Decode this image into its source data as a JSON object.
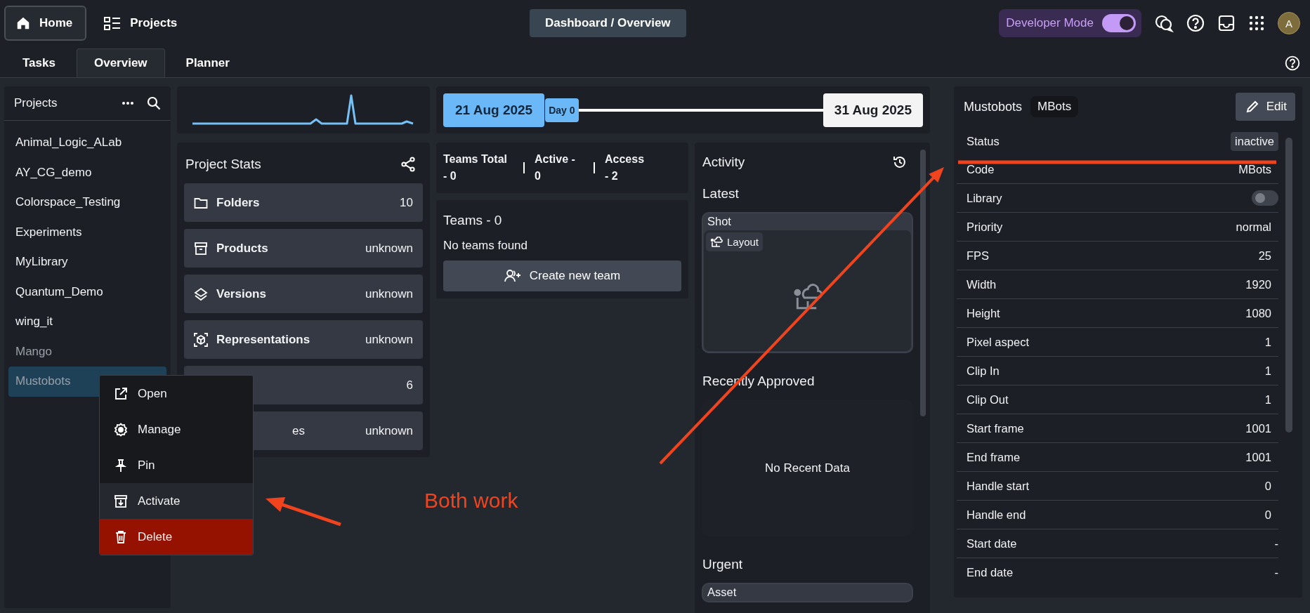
{
  "topbar": {
    "home": "Home",
    "projects": "Projects",
    "breadcrumb": "Dashboard / Overview",
    "developer_mode": {
      "label": "Developer Mode",
      "on": true
    },
    "avatar": "A"
  },
  "tabs": [
    {
      "label": "Tasks",
      "selected": false
    },
    {
      "label": "Overview",
      "selected": true
    },
    {
      "label": "Planner",
      "selected": false
    }
  ],
  "sidebar": {
    "title": "Projects",
    "items": [
      {
        "name": "Animal_Logic_ALab",
        "active": true,
        "selected": false
      },
      {
        "name": "AY_CG_demo",
        "active": true,
        "selected": false
      },
      {
        "name": "Colorspace_Testing",
        "active": true,
        "selected": false
      },
      {
        "name": "Experiments",
        "active": true,
        "selected": false
      },
      {
        "name": "MyLibrary",
        "active": true,
        "selected": false
      },
      {
        "name": "Quantum_Demo",
        "active": true,
        "selected": false
      },
      {
        "name": "wing_it",
        "active": true,
        "selected": false
      },
      {
        "name": "Mango",
        "active": false,
        "selected": false
      },
      {
        "name": "Mustobots",
        "active": false,
        "selected": true
      }
    ]
  },
  "context_menu": {
    "items": [
      {
        "label": "Open",
        "kind": "open",
        "highlighted": false
      },
      {
        "label": "Manage",
        "kind": "manage",
        "highlighted": false
      },
      {
        "label": "Pin",
        "kind": "pin",
        "highlighted": false
      },
      {
        "label": "Activate",
        "kind": "activate",
        "highlighted": true
      },
      {
        "label": "Delete",
        "kind": "delete",
        "highlighted": false
      }
    ]
  },
  "project_stats": {
    "title": "Project Stats",
    "items": [
      {
        "kind": "folders",
        "label": "Folders",
        "value": "10"
      },
      {
        "kind": "products",
        "label": "Products",
        "value": "unknown"
      },
      {
        "kind": "versions",
        "label": "Versions",
        "value": "unknown"
      },
      {
        "kind": "representations",
        "label": "Representations",
        "value": "unknown"
      },
      {
        "kind": "covered",
        "value": "6"
      },
      {
        "kind": "covered",
        "label": "es",
        "value": "unknown"
      }
    ]
  },
  "timeline": {
    "start": "21 Aug 2025",
    "day": "Day 0",
    "end": "31 Aug 2025"
  },
  "teams": {
    "stats": [
      "Teams Total - 0",
      "Active - 0",
      "Access - 2"
    ],
    "title": "Teams - 0",
    "empty": "No teams found",
    "create_button": "Create new team"
  },
  "activity": {
    "title": "Activity",
    "sections": [
      {
        "title": "Latest",
        "kind": "card",
        "card": {
          "type": "Shot",
          "tag": "Layout"
        }
      },
      {
        "title": "Recently Approved",
        "kind": "empty",
        "message": "No Recent Data"
      },
      {
        "title": "Urgent",
        "kind": "card",
        "card": {
          "type": "Asset"
        }
      }
    ]
  },
  "details": {
    "title": "Mustobots",
    "code_badge": "MBots",
    "edit_button": "Edit",
    "rows": [
      {
        "label": "Status",
        "kind": "badge",
        "value": "inactive"
      },
      {
        "label": "Code",
        "kind": "text",
        "value": "MBots"
      },
      {
        "label": "Library",
        "kind": "toggle",
        "on": false
      },
      {
        "label": "Priority",
        "kind": "text",
        "value": "normal"
      },
      {
        "label": "FPS",
        "kind": "text",
        "value": "25"
      },
      {
        "label": "Width",
        "kind": "text",
        "value": "1920"
      },
      {
        "label": "Height",
        "kind": "text",
        "value": "1080"
      },
      {
        "label": "Pixel aspect",
        "kind": "text",
        "value": "1"
      },
      {
        "label": "Clip In",
        "kind": "text",
        "value": "1"
      },
      {
        "label": "Clip Out",
        "kind": "text",
        "value": "1"
      },
      {
        "label": "Start frame",
        "kind": "text",
        "value": "1001"
      },
      {
        "label": "End frame",
        "kind": "text",
        "value": "1001"
      },
      {
        "label": "Handle start",
        "kind": "text",
        "value": "0"
      },
      {
        "label": "Handle end",
        "kind": "text",
        "value": "0"
      },
      {
        "label": "Start date",
        "kind": "text",
        "value": "-"
      },
      {
        "label": "End date",
        "kind": "text",
        "value": "-"
      }
    ]
  },
  "annotation": {
    "note": "Both work"
  }
}
